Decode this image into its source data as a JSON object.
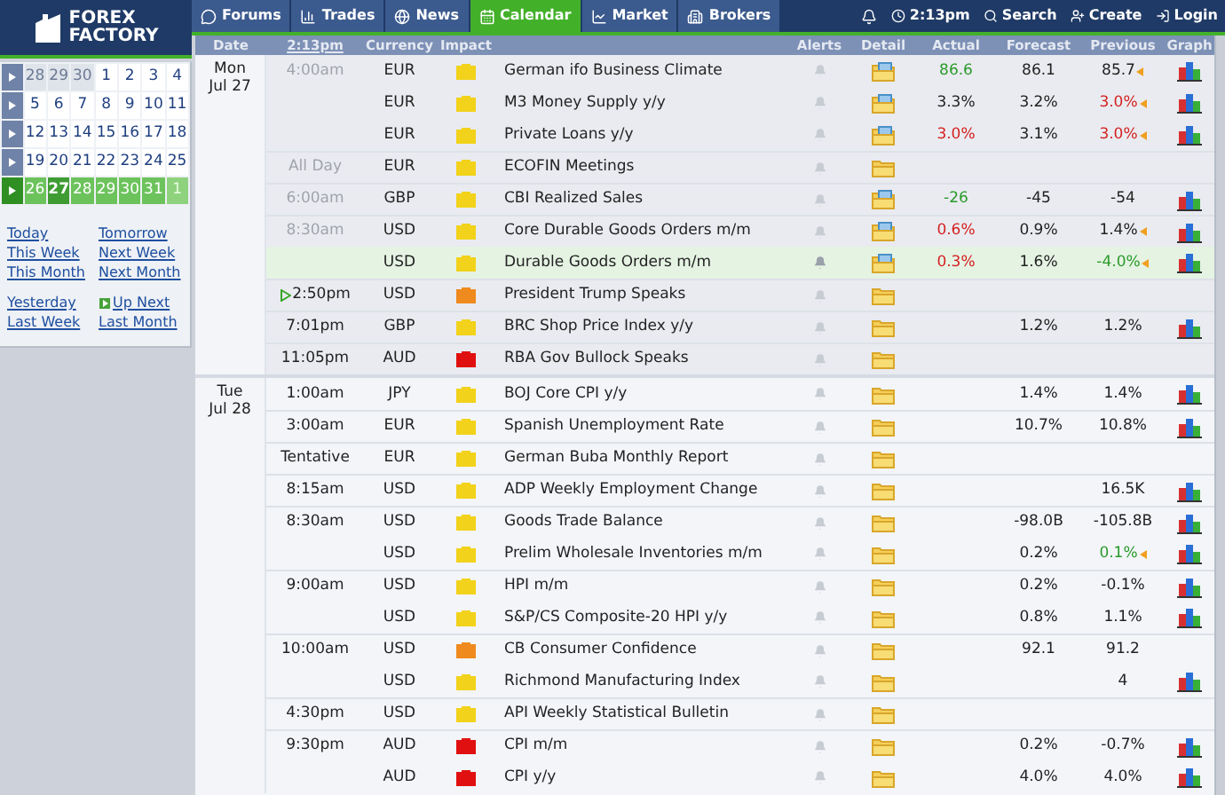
{
  "logo": {
    "line1": "FOREX",
    "line2": "FACTORY"
  },
  "nav": {
    "tabs": [
      {
        "label": "Forums",
        "selected": false
      },
      {
        "label": "Trades",
        "selected": false
      },
      {
        "label": "News",
        "selected": false
      },
      {
        "label": "Calendar",
        "selected": true
      },
      {
        "label": "Market",
        "selected": false
      },
      {
        "label": "Brokers",
        "selected": false
      }
    ],
    "tools": [
      {
        "label": "2:13pm"
      },
      {
        "label": "Search"
      },
      {
        "label": "Create"
      },
      {
        "label": "Login"
      }
    ]
  },
  "mini_calendar": {
    "weeks": [
      {
        "current": false,
        "days": [
          {
            "day": "28",
            "outside": true,
            "selected": false
          },
          {
            "day": "29",
            "outside": true,
            "selected": false
          },
          {
            "day": "30",
            "outside": true,
            "selected": false
          },
          {
            "day": "1",
            "outside": false,
            "selected": false
          },
          {
            "day": "2",
            "outside": false,
            "selected": false
          },
          {
            "day": "3",
            "outside": false,
            "selected": false
          },
          {
            "day": "4",
            "outside": false,
            "selected": false
          }
        ]
      },
      {
        "current": false,
        "days": [
          {
            "day": "5",
            "outside": false,
            "selected": false
          },
          {
            "day": "6",
            "outside": false,
            "selected": false
          },
          {
            "day": "7",
            "outside": false,
            "selected": false
          },
          {
            "day": "8",
            "outside": false,
            "selected": false
          },
          {
            "day": "9",
            "outside": false,
            "selected": false
          },
          {
            "day": "10",
            "outside": false,
            "selected": false
          },
          {
            "day": "11",
            "outside": false,
            "selected": false
          }
        ]
      },
      {
        "current": false,
        "days": [
          {
            "day": "12",
            "outside": false,
            "selected": false
          },
          {
            "day": "13",
            "outside": false,
            "selected": false
          },
          {
            "day": "14",
            "outside": false,
            "selected": false
          },
          {
            "day": "15",
            "outside": false,
            "selected": false
          },
          {
            "day": "16",
            "outside": false,
            "selected": false
          },
          {
            "day": "17",
            "outside": false,
            "selected": false
          },
          {
            "day": "18",
            "outside": false,
            "selected": false
          }
        ]
      },
      {
        "current": false,
        "days": [
          {
            "day": "19",
            "outside": false,
            "selected": false
          },
          {
            "day": "20",
            "outside": false,
            "selected": false
          },
          {
            "day": "21",
            "outside": false,
            "selected": false
          },
          {
            "day": "22",
            "outside": false,
            "selected": false
          },
          {
            "day": "23",
            "outside": false,
            "selected": false
          },
          {
            "day": "24",
            "outside": false,
            "selected": false
          },
          {
            "day": "25",
            "outside": false,
            "selected": false
          }
        ]
      },
      {
        "current": true,
        "days": [
          {
            "day": "26",
            "outside": false,
            "selected": false
          },
          {
            "day": "27",
            "outside": false,
            "selected": true
          },
          {
            "day": "28",
            "outside": false,
            "selected": false
          },
          {
            "day": "29",
            "outside": false,
            "selected": false
          },
          {
            "day": "30",
            "outside": false,
            "selected": false
          },
          {
            "day": "31",
            "outside": false,
            "selected": false
          },
          {
            "day": "1",
            "outside": true,
            "selected": false
          }
        ]
      }
    ]
  },
  "quick_links": [
    {
      "label": "Today"
    },
    {
      "label": "Tomorrow"
    },
    {
      "label": "This Week"
    },
    {
      "label": "Next Week"
    },
    {
      "label": "This Month"
    },
    {
      "label": "Next Month"
    }
  ],
  "quick_links_2": [
    {
      "label": "Yesterday",
      "icon": false
    },
    {
      "label": "Up Next",
      "icon": true
    },
    {
      "label": "Last Week",
      "icon": false
    },
    {
      "label": "Last Month",
      "icon": false
    }
  ],
  "table": {
    "columns": [
      "Date",
      "2:13pm",
      "Currency",
      "Impact",
      "Alerts",
      "Detail",
      "Actual",
      "Forecast",
      "Previous",
      "Graph"
    ],
    "days": [
      {
        "weekday": "Mon",
        "date": "Jul 27",
        "rows": [
          {
            "time": "4:00am",
            "past": true,
            "next": false,
            "currency": "EUR",
            "color": "#f2d21a",
            "event": "German ifo Business Climate",
            "actual": "86.6",
            "actual_better": true,
            "actual_worse": false,
            "forecast": "86.1",
            "previous": "85.7",
            "previous_better": false,
            "previous_worse": false,
            "revised": true,
            "graph": true,
            "detail_data": true,
            "highlighted": false
          },
          {
            "past": false,
            "next": false,
            "currency": "EUR",
            "color": "#f2d21a",
            "event": "M3 Money Supply y/y",
            "actual": "3.3%",
            "actual_better": false,
            "actual_worse": false,
            "forecast": "3.2%",
            "previous": "3.0%",
            "previous_better": false,
            "previous_worse": true,
            "revised": true,
            "graph": true,
            "detail_data": true,
            "highlighted": false
          },
          {
            "past": false,
            "next": false,
            "currency": "EUR",
            "color": "#f2d21a",
            "event": "Private Loans y/y",
            "actual": "3.0%",
            "actual_better": false,
            "actual_worse": true,
            "forecast": "3.1%",
            "previous": "3.0%",
            "previous_better": false,
            "previous_worse": true,
            "revised": true,
            "graph": true,
            "detail_data": true,
            "highlighted": false
          },
          {
            "time": "All Day",
            "past": true,
            "next": false,
            "currency": "EUR",
            "color": "#f2d21a",
            "event": "ECOFIN Meetings",
            "revised": false,
            "graph": false,
            "detail_data": false,
            "highlighted": false
          },
          {
            "time": "6:00am",
            "past": true,
            "next": false,
            "currency": "GBP",
            "color": "#f2d21a",
            "event": "CBI Realized Sales",
            "actual": "-26",
            "actual_better": true,
            "actual_worse": false,
            "forecast": "-45",
            "previous": "-54",
            "previous_better": false,
            "previous_worse": false,
            "revised": false,
            "graph": true,
            "detail_data": true,
            "highlighted": false
          },
          {
            "time": "8:30am",
            "past": true,
            "next": false,
            "currency": "USD",
            "color": "#f2d21a",
            "event": "Core Durable Goods Orders m/m",
            "actual": "0.6%",
            "actual_better": false,
            "actual_worse": true,
            "forecast": "0.9%",
            "previous": "1.4%",
            "previous_better": false,
            "previous_worse": false,
            "revised": true,
            "graph": true,
            "detail_data": true,
            "highlighted": false
          },
          {
            "past": false,
            "next": false,
            "currency": "USD",
            "color": "#f2d21a",
            "event": "Durable Goods Orders m/m",
            "actual": "0.3%",
            "actual_better": false,
            "actual_worse": true,
            "forecast": "1.6%",
            "previous": "-4.0%",
            "previous_better": true,
            "previous_worse": false,
            "revised": true,
            "graph": true,
            "detail_data": true,
            "highlighted": true
          },
          {
            "time": "2:50pm",
            "past": false,
            "next": true,
            "currency": "USD",
            "color": "#ef8a1e",
            "event": "President Trump Speaks",
            "revised": false,
            "graph": false,
            "detail_data": false,
            "highlighted": false
          },
          {
            "time": "7:01pm",
            "past": false,
            "next": false,
            "currency": "GBP",
            "color": "#f2d21a",
            "event": "BRC Shop Price Index y/y",
            "forecast": "1.2%",
            "previous": "1.2%",
            "previous_better": false,
            "previous_worse": false,
            "revised": false,
            "graph": true,
            "detail_data": false,
            "highlighted": false
          },
          {
            "time": "11:05pm",
            "past": false,
            "next": false,
            "currency": "AUD",
            "color": "#e01010",
            "event": "RBA Gov Bullock Speaks",
            "revised": false,
            "graph": false,
            "detail_data": false,
            "highlighted": false
          }
        ]
      },
      {
        "weekday": "Tue",
        "date": "Jul 28",
        "rows": [
          {
            "time": "1:00am",
            "past": false,
            "next": false,
            "currency": "JPY",
            "color": "#f2d21a",
            "event": "BOJ Core CPI y/y",
            "forecast": "1.4%",
            "previous": "1.4%",
            "previous_better": false,
            "previous_worse": false,
            "revised": false,
            "graph": true,
            "detail_data": false,
            "highlighted": false
          },
          {
            "time": "3:00am",
            "past": false,
            "next": false,
            "currency": "EUR",
            "color": "#f2d21a",
            "event": "Spanish Unemployment Rate",
            "forecast": "10.7%",
            "previous": "10.8%",
            "previous_better": false,
            "previous_worse": false,
            "revised": false,
            "graph": true,
            "detail_data": false,
            "highlighted": false
          },
          {
            "time": "Tentative",
            "past": false,
            "next": false,
            "currency": "EUR",
            "color": "#f2d21a",
            "event": "German Buba Monthly Report",
            "revised": false,
            "graph": false,
            "detail_data": false,
            "highlighted": false
          },
          {
            "time": "8:15am",
            "past": false,
            "next": false,
            "currency": "USD",
            "color": "#f2d21a",
            "event": "ADP Weekly Employment Change",
            "previous": "16.5K",
            "previous_better": false,
            "previous_worse": false,
            "revised": false,
            "graph": true,
            "detail_data": false,
            "highlighted": false
          },
          {
            "time": "8:30am",
            "past": false,
            "next": false,
            "currency": "USD",
            "color": "#f2d21a",
            "event": "Goods Trade Balance",
            "forecast": "-98.0B",
            "previous": "-105.8B",
            "previous_better": false,
            "previous_worse": false,
            "revised": false,
            "graph": true,
            "detail_data": false,
            "highlighted": false
          },
          {
            "past": false,
            "next": false,
            "currency": "USD",
            "color": "#f2d21a",
            "event": "Prelim Wholesale Inventories m/m",
            "forecast": "0.2%",
            "previous": "0.1%",
            "previous_better": true,
            "previous_worse": false,
            "revised": true,
            "graph": true,
            "detail_data": false,
            "highlighted": false
          },
          {
            "time": "9:00am",
            "past": false,
            "next": false,
            "currency": "USD",
            "color": "#f2d21a",
            "event": "HPI m/m",
            "forecast": "0.2%",
            "previous": "-0.1%",
            "previous_better": false,
            "previous_worse": false,
            "revised": false,
            "graph": true,
            "detail_data": false,
            "highlighted": false
          },
          {
            "past": false,
            "next": false,
            "currency": "USD",
            "color": "#f2d21a",
            "event": "S&P/CS Composite-20 HPI y/y",
            "forecast": "0.8%",
            "previous": "1.1%",
            "previous_better": false,
            "previous_worse": false,
            "revised": false,
            "graph": true,
            "detail_data": false,
            "highlighted": false
          },
          {
            "time": "10:00am",
            "past": false,
            "next": false,
            "currency": "USD",
            "color": "#ef8a1e",
            "event": "CB Consumer Confidence",
            "forecast": "92.1",
            "previous": "91.2",
            "previous_better": false,
            "previous_worse": false,
            "revised": false,
            "graph": false,
            "detail_data": false,
            "highlighted": false
          },
          {
            "past": false,
            "next": false,
            "currency": "USD",
            "color": "#f2d21a",
            "event": "Richmond Manufacturing Index",
            "previous": "4",
            "previous_better": false,
            "previous_worse": false,
            "revised": false,
            "graph": true,
            "detail_data": false,
            "highlighted": false
          },
          {
            "time": "4:30pm",
            "past": false,
            "next": false,
            "currency": "USD",
            "color": "#f2d21a",
            "event": "API Weekly Statistical Bulletin",
            "revised": false,
            "graph": false,
            "detail_data": false,
            "highlighted": false
          },
          {
            "time": "9:30pm",
            "past": false,
            "next": false,
            "currency": "AUD",
            "color": "#e01010",
            "event": "CPI m/m",
            "forecast": "0.2%",
            "previous": "-0.7%",
            "previous_better": false,
            "previous_worse": false,
            "revised": false,
            "graph": true,
            "detail_data": false,
            "highlighted": false
          },
          {
            "past": false,
            "next": false,
            "currency": "AUD",
            "color": "#e01010",
            "event": "CPI y/y",
            "forecast": "4.0%",
            "previous": "4.0%",
            "previous_better": false,
            "previous_worse": false,
            "revised": false,
            "graph": true,
            "detail_data": false,
            "highlighted": false
          }
        ]
      }
    ]
  }
}
